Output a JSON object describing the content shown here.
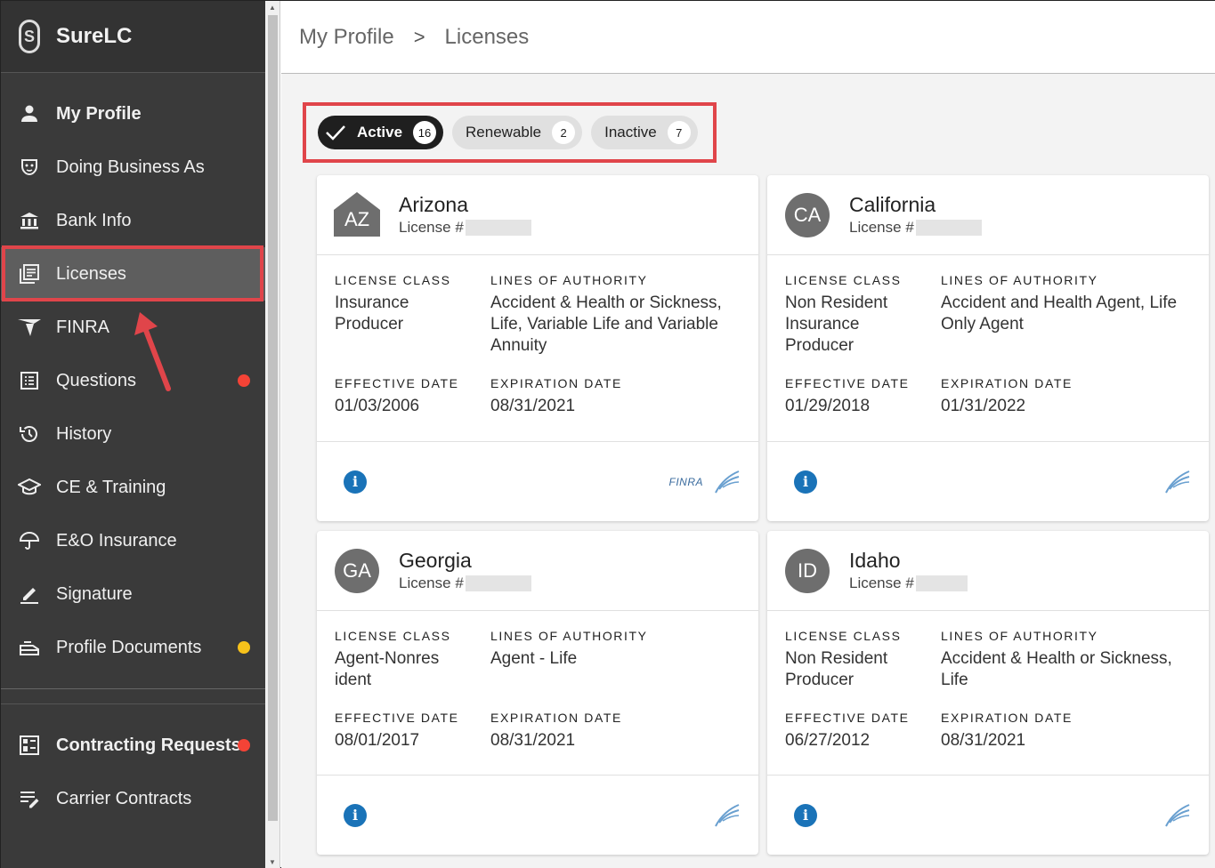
{
  "app": {
    "name": "SureLC"
  },
  "sidebar": {
    "items": [
      {
        "label": "My Profile",
        "icon": "person-icon"
      },
      {
        "label": "Doing Business As",
        "icon": "mask-icon"
      },
      {
        "label": "Bank Info",
        "icon": "bank-icon"
      },
      {
        "label": "Licenses",
        "icon": "licenses-icon"
      },
      {
        "label": "FINRA",
        "icon": "finra-icon"
      },
      {
        "label": "Questions",
        "icon": "questions-icon",
        "badge_color": "#f44336"
      },
      {
        "label": "History",
        "icon": "history-icon"
      },
      {
        "label": "CE & Training",
        "icon": "graduation-cap-icon"
      },
      {
        "label": "E&O Insurance",
        "icon": "umbrella-icon"
      },
      {
        "label": "Signature",
        "icon": "pen-icon"
      },
      {
        "label": "Profile Documents",
        "icon": "documents-icon",
        "badge_color": "#f7c21b"
      }
    ],
    "secondary": [
      {
        "label": "Contracting Requests",
        "icon": "requests-icon",
        "badge_color": "#f44336"
      },
      {
        "label": "Carrier Contracts",
        "icon": "contracts-icon"
      }
    ]
  },
  "breadcrumb": {
    "parent": "My Profile",
    "current": "Licenses",
    "separator": ">"
  },
  "filters": [
    {
      "label": "Active",
      "count": "16",
      "selected": true
    },
    {
      "label": "Renewable",
      "count": "2",
      "selected": false
    },
    {
      "label": "Inactive",
      "count": "7",
      "selected": false
    }
  ],
  "labels": {
    "license_class": "LICENSE CLASS",
    "lines_of_authority": "LINES OF AUTHORITY",
    "effective_date": "EFFECTIVE DATE",
    "expiration_date": "EXPIRATION DATE",
    "license_prefix": "License #"
  },
  "cards": [
    {
      "abbr": "AZ",
      "state": "Arizona",
      "license_class": "Insurance Producer",
      "lines": "Accident & Health or Sickness, Life, Variable Life and Variable Annuity",
      "effective": "01/03/2006",
      "expiration": "08/31/2021",
      "finra": "FINRA"
    },
    {
      "abbr": "CA",
      "state": "California",
      "license_class": "Non Resident Insurance Producer",
      "lines": "Accident and Health Agent, Life Only Agent",
      "effective": "01/29/2018",
      "expiration": "01/31/2022"
    },
    {
      "abbr": "GA",
      "state": "Georgia",
      "license_class": "Agent-Nonresident",
      "lines": "Agent - Life",
      "effective": "08/01/2017",
      "expiration": "08/31/2021"
    },
    {
      "abbr": "ID",
      "state": "Idaho",
      "license_class": "Non Resident Producer",
      "lines": "Accident & Health or Sickness, Life",
      "effective": "06/27/2012",
      "expiration": "08/31/2021"
    }
  ],
  "colors": {
    "highlight": "#e0454a",
    "sidebar_bg": "#3a3a3a",
    "info_blue": "#1a73b8"
  }
}
